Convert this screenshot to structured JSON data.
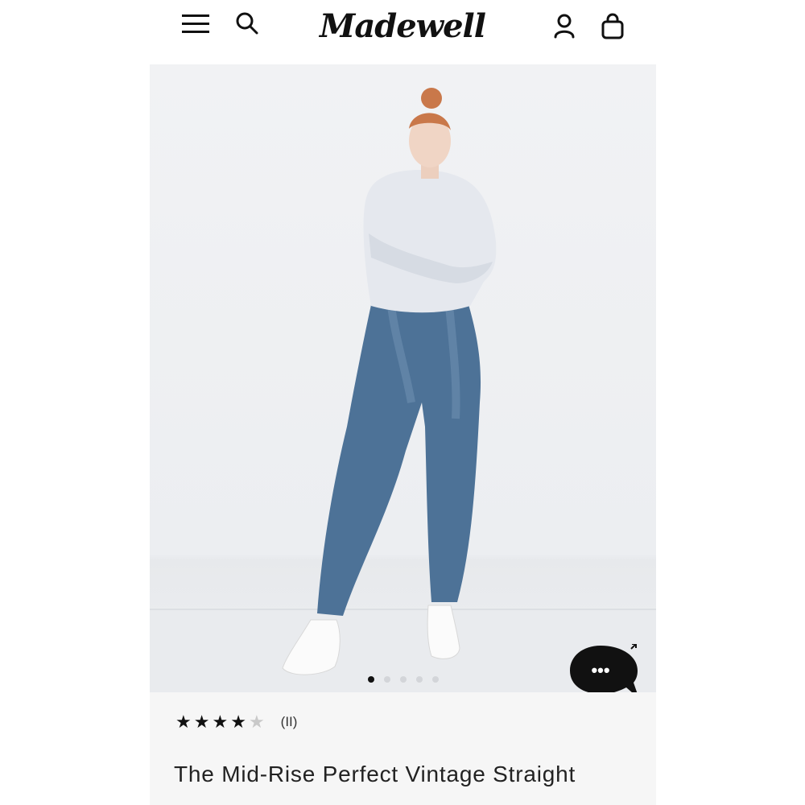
{
  "header": {
    "brand": "Madewell",
    "icons": [
      "menu-icon",
      "search-icon",
      "account-icon",
      "bag-icon"
    ]
  },
  "hero": {
    "image_alt": "Model wearing mid-rise straight jeans",
    "carousel": {
      "total": 5,
      "active": 1
    }
  },
  "chat": {
    "icon": "chat-icon",
    "label": "•••"
  },
  "product": {
    "rating": 4,
    "rating_max": 5,
    "review_count": "(II)",
    "title": "The Mid-Rise Perfect Vintage Straight"
  }
}
